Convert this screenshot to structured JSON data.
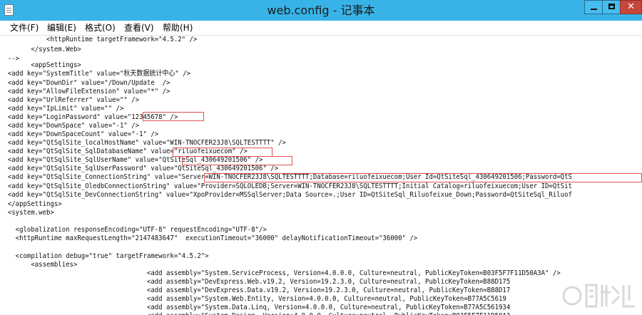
{
  "window": {
    "title": "web.config - 记事本"
  },
  "menu": [
    "文件(F)",
    "编辑(E)",
    "格式(O)",
    "查看(V)",
    "帮助(H)"
  ],
  "editor_lines": [
    "            <httpRuntime targetFramework=\"4.5.2\" />",
    "        </system.Web>",
    "  -->",
    "        <appSettings>",
    "  <add key=\"SystemTitle\" value=\"秋天数据统计中心\" />",
    "  <add key=\"DownDir\" value=\"/Down/Update  />",
    "  <add key=\"AllowFileExtension\" value=\"*\" />",
    "  <add key=\"UrlReferrer\" value=\"\" />",
    "  <add key=\"IpLimit\" value=\"\" />",
    "  <add key=\"LoginPassword\" value=\"12345678\" />",
    "  <add key=\"DownSpace\" value=\"-1\" />",
    "  <add key=\"DownSpaceCount\" value=\"-1\" />",
    "  <add key=\"QtSqlSite_localHostName\" value=\"WIN-TNOCFER23J8\\SQLTESTTTT\" />",
    "  <add key=\"QtSqlSite_SqlDatabaseName\" value=\"riluofeixuecom\" />",
    "  <add key=\"QtSqlSite_SqlUserName\" value=\"QtSiteSql_430649201506\" />",
    "  <add key=\"QtSqlSite_SqlUserPassword\" value=\"QtSiteSql_430649201506\" />",
    "  <add key=\"QtSqlSite_ConnectionString\" value=\"Server=WIN-TNOCFER23J8\\SQLTESTTTT;Database=riluofeixuecom;User Id=QtSiteSql_430649201506;Password=QtS",
    "  <add key=\"QtSqlSite_OledbConnectionString\" value=\"Provider=SQLOLEDB;Server=WIN-TNOCFER23J8\\SQLTESTTTT;Initial Catalog=riluofeixuecom;User ID=QtSit",
    "  <add key=\"QtSqlSite_DevConnectionString\" value=\"XpoProvider=MSSqlServer;Data Source=.;User ID=QtSiteSql_Riluofeixue_Down;Password=QtSiteSql_Riluof",
    "  </appSettings>",
    "  <system.web>",
    "",
    "    <globalization responseEncoding=\"UTF-8\" requestEncoding=\"UTF-8\"/>",
    "    <httpRuntime maxRequestLength=\"2147483647\"  executionTimeout=\"36000\" delayNotificationTimeout=\"36000\" />",
    "",
    "    <compilation debug=\"true\" targetFramework=\"4.5.2\">",
    "        <assemblies>",
    "                                      <add assembly=\"System.ServiceProcess, Version=4.0.0.0, Culture=neutral, PublicKeyToken=B03F5F7F11D50A3A\" />",
    "                                      <add assembly=\"DevExpress.Web.v19.2, Version=19.2.3.0, Culture=neutral, PublicKeyToken=B88D175",
    "                                      <add assembly=\"DevExpress.Data.v19.2, Version=19.2.3.0, Culture=neutral, PublicKeyToken=B88D17",
    "                                      <add assembly=\"System.Web.Entity, Version=4.0.0.0, Culture=neutral, PublicKeyToken=B77A5C5619",
    "                                      <add assembly=\"System.Data.Linq, Version=4.0.0.0, Culture=neutral, PublicKeyToken=B77A5C561934",
    "                                      <add assembly=\"System.Design, Version=4.0.0.0, Culture=neutral, PublicKeyToken=B03F5F7F11D50A3"
  ],
  "colors": {
    "titlebar": "#38b3e8",
    "highlight_box": "#e05252",
    "close_button": "#c7463c"
  },
  "icons": {
    "app": "notepad-icon",
    "minimize": "minimize-icon",
    "maximize": "maximize-icon",
    "close": "close-icon"
  }
}
